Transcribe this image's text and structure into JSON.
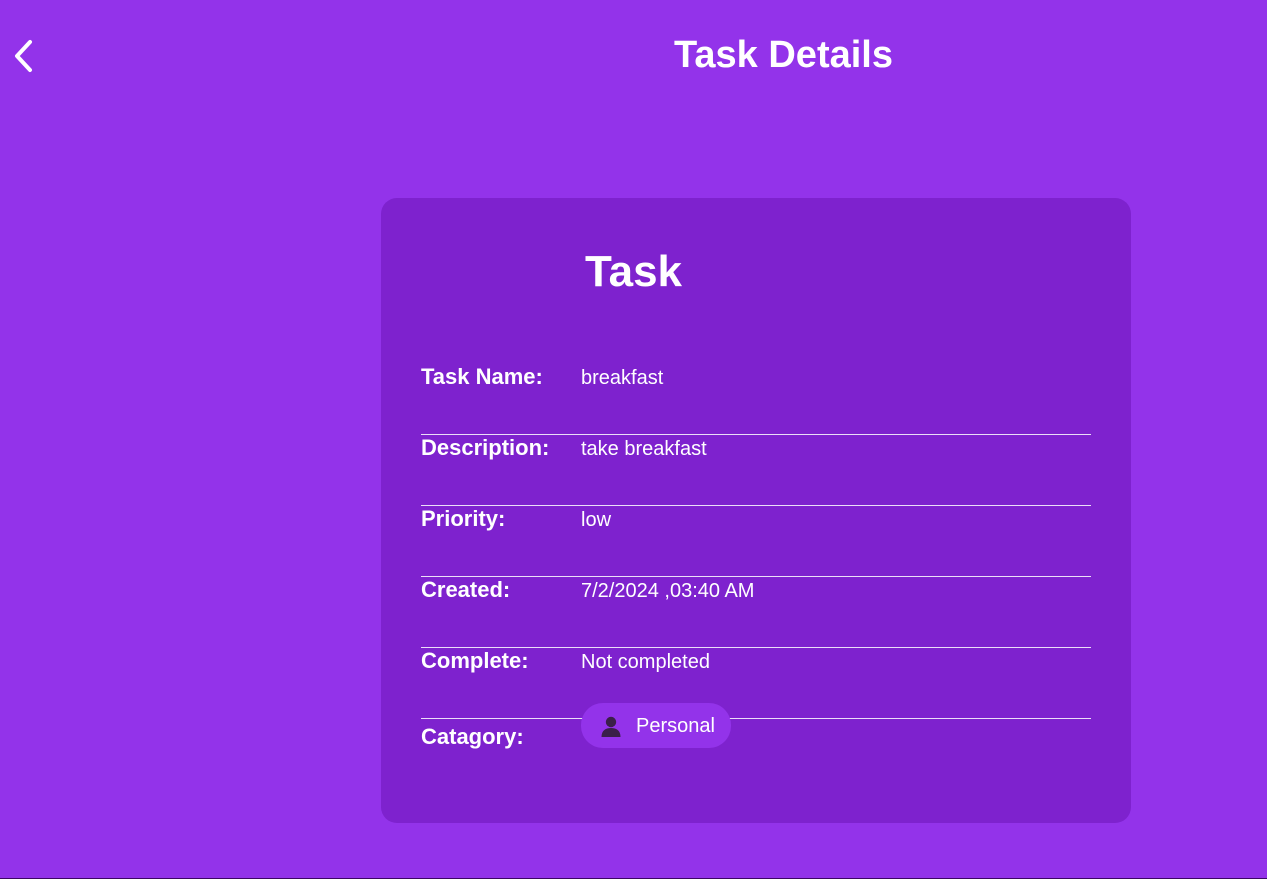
{
  "header": {
    "title": "Task Details",
    "back_icon": "chevron-left-icon"
  },
  "card": {
    "title": "Task",
    "fields": [
      {
        "label": "Task Name:",
        "value": "breakfast"
      },
      {
        "label": "Description:",
        "value": "take breakfast"
      },
      {
        "label": "Priority:",
        "value": "low"
      },
      {
        "label": "Created:",
        "value": "7/2/2024 ,03:40 AM"
      },
      {
        "label": "Complete:",
        "value": "Not completed"
      }
    ],
    "category": {
      "label": "Catagory:",
      "value": "Personal",
      "icon": "person-icon"
    }
  },
  "colors": {
    "background": "#9333ea",
    "card": "#7e22ce",
    "chip": "#9333ea",
    "text": "#ffffff"
  }
}
